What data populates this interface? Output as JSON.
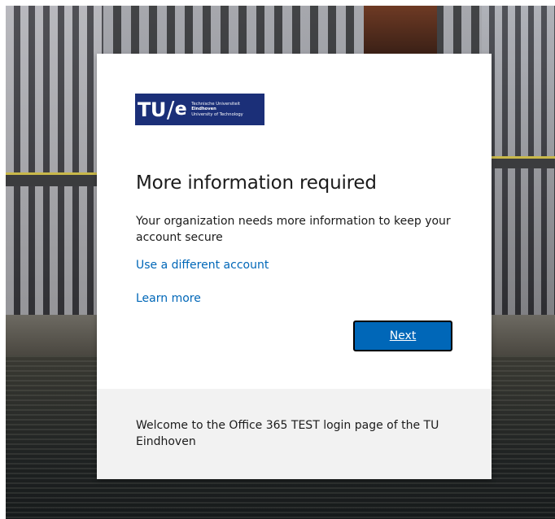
{
  "logo": {
    "mark_tu": "TU",
    "mark_slash": "/",
    "mark_e": "e",
    "line1": "Technische Universiteit",
    "line2": "Eindhoven",
    "line3": "University of Technology",
    "color": "#1b2f78"
  },
  "main": {
    "title": "More information required",
    "description": "Your organization needs more information to keep your account secure",
    "use_different_account": "Use a different account",
    "learn_more": "Learn more",
    "next_label": "Next"
  },
  "footer": {
    "text": "Welcome to the Office 365 TEST login page of the TU Eindhoven"
  },
  "colors": {
    "link": "#0067b8",
    "button": "#0067b8",
    "footer_bg": "#f2f2f2"
  }
}
